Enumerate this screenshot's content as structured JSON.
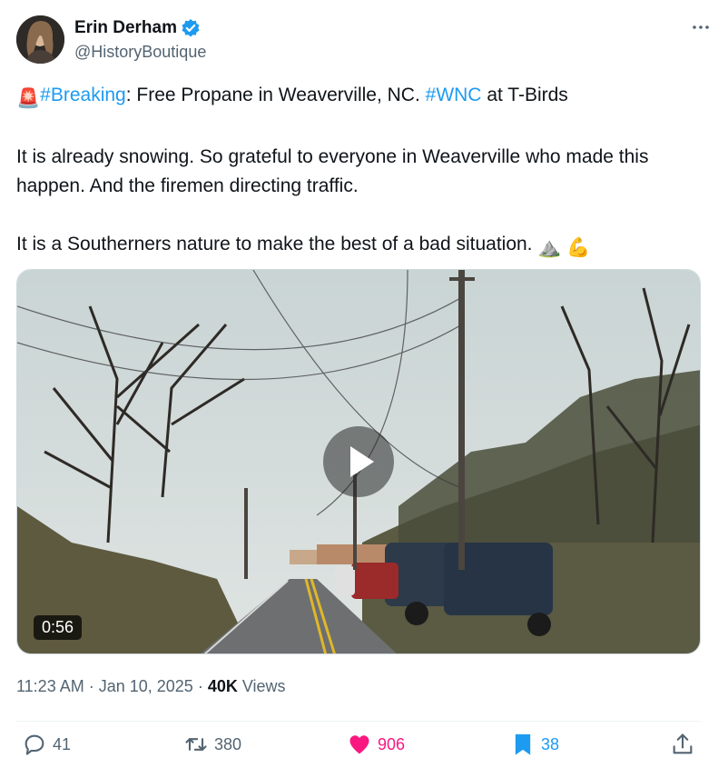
{
  "author": {
    "name": "Erin Derham",
    "handle": "@HistoryBoutique",
    "verified": true,
    "verified_color": "#1d9bf0"
  },
  "more_icon": "more-horizontal-icon",
  "tweet": {
    "line1_emoji": "🚨",
    "hashtag_breaking": "#Breaking",
    "line1_mid": ": Free Propane in Weaverville, NC. ",
    "hashtag_wnc": "#WNC",
    "line1_end": " at T-Birds",
    "paragraph2": "It is already snowing. So grateful to everyone in Weaverville who made this happen. And the firemen directing traffic.",
    "paragraph3": "It is a Southerners nature to make the best of a bad situation.",
    "paragraph3_emojis": [
      "⛰️",
      "💪"
    ],
    "link_color": "#1d9bf0"
  },
  "video": {
    "duration": "0:56",
    "play_icon": "play-icon"
  },
  "meta": {
    "time": "11:23 AM",
    "sep1": " · ",
    "date": "Jan 10, 2025",
    "sep2": " · ",
    "views_count": "40K",
    "views_label": " Views"
  },
  "actions": {
    "replies": "41",
    "reposts": "380",
    "likes": "906",
    "bookmarks": "38",
    "like_color": "#f91880",
    "bookmark_color": "#1d9bf0"
  }
}
